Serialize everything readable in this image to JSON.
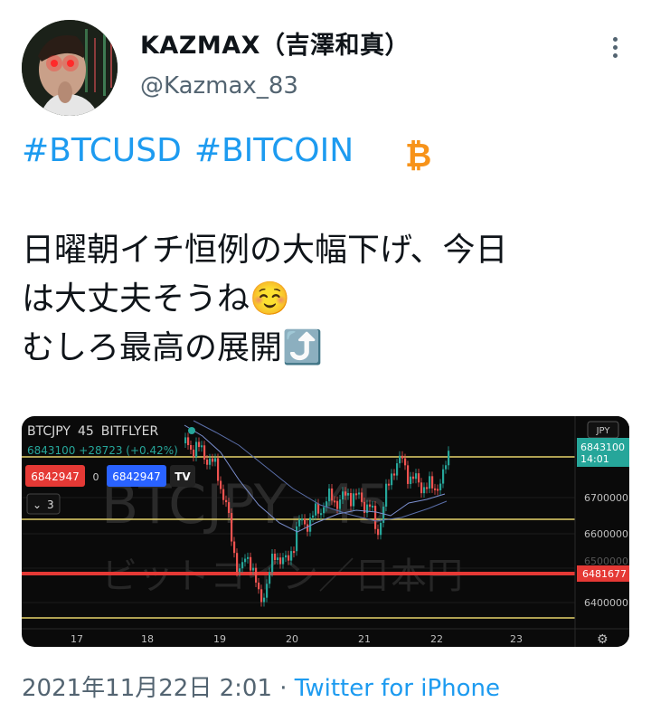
{
  "tweet": {
    "display_name": "KAZMAX（吉澤和真）",
    "handle": "@Kazmax_83",
    "hashtags": [
      "#BTCUSD",
      "#BITCOIN"
    ],
    "lines": [
      "日曜朝イチ恒例の大幅下げ、今日",
      "は大丈夫そうね☺️",
      "むしろ最高の展開⤴️"
    ],
    "timestamp": "2021年11月22日 2:01",
    "separator": "·",
    "source": "Twitter for iPhone"
  },
  "chart": {
    "symbol": "BTCJPY",
    "interval": "45",
    "exchange": "BITFLYER",
    "last_info": "6843100 +28723 (+0.42%)",
    "sell_price": "6842947",
    "spread": "0",
    "buy_price": "6842947",
    "indicator_count": "3",
    "watermark_symbol": "BTCJPY, 45",
    "watermark_name": "ビットコイン／日本円",
    "currency": "JPY",
    "price_label": "6843100",
    "countdown": "14:01",
    "level_label": "6481677",
    "y_ticks": [
      "6700000",
      "6600000",
      "6500000",
      "6400000"
    ],
    "x_ticks": [
      "17",
      "18",
      "19",
      "20",
      "21",
      "22",
      "23"
    ],
    "colors": {
      "up": "#26a69a",
      "down": "#ef5350",
      "level": "#e53935",
      "hline": "#e6d36a",
      "sell": "#e53935",
      "buy": "#2962ff"
    }
  }
}
